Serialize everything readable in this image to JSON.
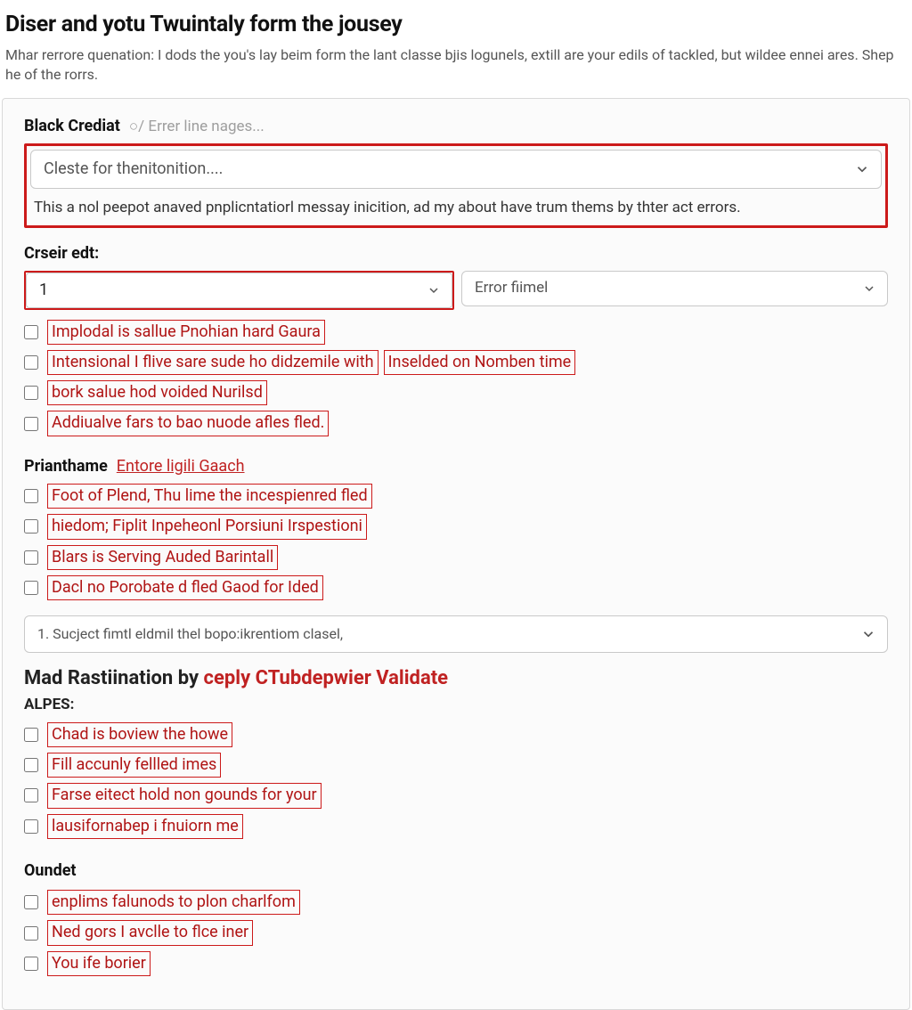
{
  "header": {
    "title": "Diser and yotu Twuintaly form the jousey",
    "subtitle": "Mhar rerrore quenation: I dods the you's lay beim form the lant classe bjis logunels, extill are your edils of tackled, but wildee ennei ares. Shep he of the rorrs."
  },
  "section1": {
    "label": "Black Crediat",
    "meta": " ○/  Errer line nages...",
    "select_placeholder": "Cleste for thenitonition....",
    "helper": "This a nol peepot anaved pnplicntatiorl messay inicition, ad my about have trum thems by thter act errors."
  },
  "crseir": {
    "label": "Crseir edt:",
    "left_value": "1",
    "right_placeholder": "Error fiimel",
    "items": [
      "Implodal is sallue Pnohian hard Gaura",
      "bork salue hod voided Nurilsd",
      "Addiualve fars to bao nuode afles fled."
    ],
    "pair_item": {
      "a": "Intensional I flive sare sude ho didzemile with",
      "b": "Inselded on Nomben time"
    }
  },
  "prian": {
    "label": "Prianthame",
    "link": "Entore ligili Gaach",
    "items": [
      "Foot of Plend, Thu lime the incespienred fled",
      "hiedom; Fiplit Inpeheonl Porsiuni Irspestioni",
      "Blars is Serving Auded Barintall",
      "Dacl no Porobate d fled Gaod for Ided"
    ]
  },
  "subject_select": {
    "value": "1. Sucject fimtl eldmil thel bopo:ikrentiom clasel,"
  },
  "validate": {
    "heading_plain": "Mad Rastiination by ",
    "heading_red": "ceply CTubdepwier Validate",
    "alpes_label": "ALPES:",
    "items": [
      "Chad is boview the howe",
      "Fill accunly fellled imes",
      "Farse eitect hold non gounds for your",
      "lausifornabep i fnuiorn me"
    ]
  },
  "oundet": {
    "label": "Oundet",
    "items": [
      "enplims falunods to plon charlfom",
      "Ned gors I avclle to flce iner",
      "You ife borier"
    ]
  }
}
